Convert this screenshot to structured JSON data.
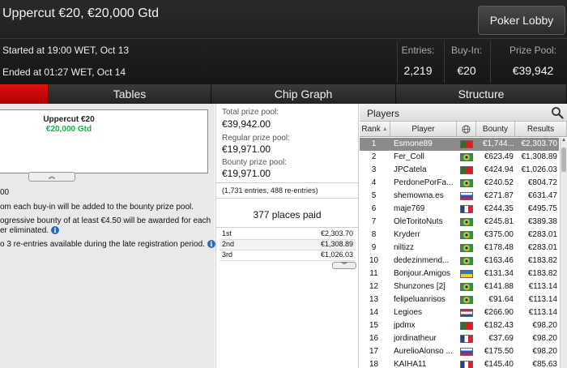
{
  "header": {
    "title": "Uppercut €20, €20,000 Gtd",
    "lobby_button": "Poker Lobby",
    "started": "Started at 19:00 WET, Oct 13",
    "ended": "Ended at 01:27 WET, Oct 14",
    "entries_label": "Entries:",
    "entries_value": "2,219",
    "buyin_label": "Buy-In:",
    "buyin_value": "€20",
    "prizepool_label": "Prize Pool:",
    "prizepool_value": "€39,942"
  },
  "tabs": [
    {
      "label": ""
    },
    {
      "label": "Tables"
    },
    {
      "label": "Chip Graph"
    },
    {
      "label": "Structure"
    }
  ],
  "info": {
    "name": "Uppercut €20",
    "gtd": "€20,000 Gtd",
    "rules": [
      "00",
      "om each buy-in will be added to the bounty prize pool.",
      "ogressive bounty of at least €4.50 will be awarded for each",
      "er eliminated.",
      "o 3 re-entries available during the late registration period."
    ]
  },
  "prizes": {
    "total_label": "Total prize pool:",
    "total_value": "€39,942.00",
    "regular_label": "Regular prize pool:",
    "regular_value": "€19,971.00",
    "bounty_label": "Bounty prize pool:",
    "bounty_value": "€19,971.00",
    "entries_note": "(1,731 entries, 488 re-entries)",
    "places_paid": "377 places paid",
    "payouts": [
      {
        "place": "1st",
        "amount": "€2,303.70"
      },
      {
        "place": "2nd",
        "amount": "€1,308.89"
      },
      {
        "place": "3rd",
        "amount": "€1,026.03"
      }
    ]
  },
  "players": {
    "title": "Players",
    "columns": {
      "rank": "Rank",
      "player": "Player",
      "bounty": "Bounty",
      "results": "Results"
    },
    "rows": [
      {
        "rank": "1",
        "name": "Esmone89",
        "flag": "portugal",
        "bounty": "€1,744...",
        "results": "€2,303.70"
      },
      {
        "rank": "2",
        "name": "Fer_Coll",
        "flag": "brazil",
        "bounty": "€623.49",
        "results": "€1,308.89"
      },
      {
        "rank": "3",
        "name": "JPCatela",
        "flag": "portugal",
        "bounty": "€424.94",
        "results": "€1,026.03"
      },
      {
        "rank": "4",
        "name": "PerdonePorFa...",
        "flag": "brazil",
        "bounty": "€240.52",
        "results": "€804.72"
      },
      {
        "rank": "5",
        "name": "shemowna.es",
        "flag": "russia",
        "bounty": "€271.87",
        "results": "€631.47"
      },
      {
        "rank": "6",
        "name": "maje769",
        "flag": "france",
        "bounty": "€244.35",
        "results": "€495.75"
      },
      {
        "rank": "7",
        "name": "OleToritoNuts",
        "flag": "brazil",
        "bounty": "€245.81",
        "results": "€389.38"
      },
      {
        "rank": "8",
        "name": "Kryderr",
        "flag": "brazil",
        "bounty": "€375.00",
        "results": "€283.01"
      },
      {
        "rank": "9",
        "name": "niltizz",
        "flag": "brazil",
        "bounty": "€178.48",
        "results": "€283.01"
      },
      {
        "rank": "10",
        "name": "dedezinmend...",
        "flag": "brazil",
        "bounty": "€163.46",
        "results": "€183.82"
      },
      {
        "rank": "11",
        "name": "Bonjour.Amigos",
        "flag": "ukraine",
        "bounty": "€131.34",
        "results": "€183.82"
      },
      {
        "rank": "12",
        "name": "Shunzones [2]",
        "flag": "brazil",
        "bounty": "€141.88",
        "results": "€113.14"
      },
      {
        "rank": "13",
        "name": "felipeluanrisos",
        "flag": "brazil",
        "bounty": "€91.64",
        "results": "€113.14"
      },
      {
        "rank": "14",
        "name": "Legioes",
        "flag": "netherlands",
        "bounty": "€266.90",
        "results": "€113.14"
      },
      {
        "rank": "15",
        "name": "jpdmx",
        "flag": "portugal",
        "bounty": "€182.43",
        "results": "€98.20"
      },
      {
        "rank": "16",
        "name": "jordinatheur",
        "flag": "france",
        "bounty": "€37.69",
        "results": "€98.20"
      },
      {
        "rank": "17",
        "name": "AurelioAlonso ...",
        "flag": "russia",
        "bounty": "€175.50",
        "results": "€98.20"
      },
      {
        "rank": "18",
        "name": "KAIHA11",
        "flag": "france",
        "bounty": "€145.40",
        "results": "€85.63"
      }
    ]
  },
  "colors": {
    "accent": "#d40000",
    "gtd_green": "#1caa4a",
    "selected_row": "#8b8b8b"
  }
}
